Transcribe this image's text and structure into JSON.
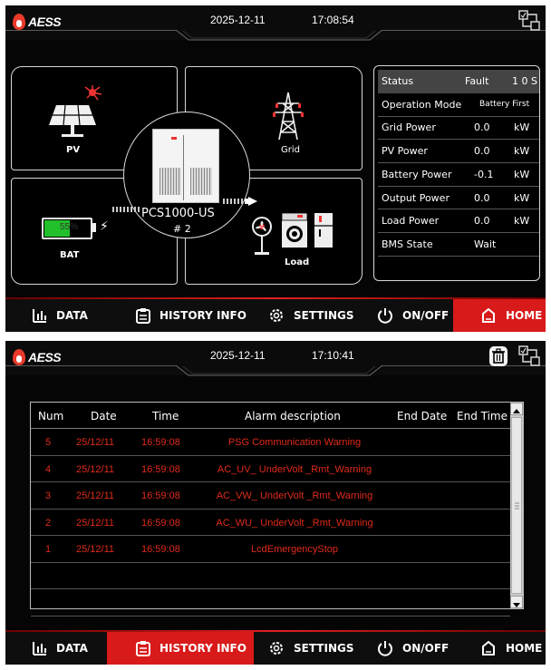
{
  "brand": "AESS",
  "screens": {
    "home": {
      "header": {
        "date": "2025-12-11",
        "time": "17:08:54"
      },
      "pv_label": "PV",
      "grid_label": "Grid",
      "bat_label": "BAT",
      "bat_percent_text": "55%",
      "bat_level": 0.55,
      "load_label": "Load",
      "pcs_model": "PCS1000-US",
      "pcs_number": "# 2",
      "status": {
        "header_label": "Status",
        "header_value": "Fault",
        "header_extra": "1 0 S",
        "rows": [
          {
            "label": "Operation Mode",
            "value": "Battery First",
            "unit": ""
          },
          {
            "label": "Grid Power",
            "value": "0.0",
            "unit": "kW"
          },
          {
            "label": "PV Power",
            "value": "0.0",
            "unit": "kW"
          },
          {
            "label": "Battery Power",
            "value": "-0.1",
            "unit": "kW"
          },
          {
            "label": "Output Power",
            "value": "0.0",
            "unit": "kW"
          },
          {
            "label": "Load Power",
            "value": "0.0",
            "unit": "kW"
          },
          {
            "label": "BMS State",
            "value": "Wait",
            "unit": ""
          }
        ]
      },
      "active_nav": "home"
    },
    "history": {
      "header": {
        "date": "2025-12-11",
        "time": "17:10:41"
      },
      "columns": [
        "Num",
        "Date",
        "Time",
        "Alarm description",
        "End Date",
        "End Time"
      ],
      "rows": [
        {
          "num": "5",
          "date": "25/12/11",
          "time": "16:59:08",
          "desc": "PSG Communication Warning",
          "end_date": "",
          "end_time": ""
        },
        {
          "num": "4",
          "date": "25/12/11",
          "time": "16:59:08",
          "desc": "AC_UV_ UnderVolt _Rmt_Warning",
          "end_date": "",
          "end_time": ""
        },
        {
          "num": "3",
          "date": "25/12/11",
          "time": "16:59:08",
          "desc": "AC_VW_ UnderVolt _Rmt_Warning",
          "end_date": "",
          "end_time": ""
        },
        {
          "num": "2",
          "date": "25/12/11",
          "time": "16:59:08",
          "desc": "AC_WU_ UnderVolt _Rmt_Warning",
          "end_date": "",
          "end_time": ""
        },
        {
          "num": "1",
          "date": "25/12/11",
          "time": "16:59:08",
          "desc": "LcdEmergencyStop",
          "end_date": "",
          "end_time": ""
        }
      ],
      "active_nav": "history"
    }
  },
  "nav": {
    "data": "DATA",
    "history": "HISTORY INFO",
    "settings": "SETTINGS",
    "onoff": "ON/OFF",
    "home": "HOME"
  },
  "colors": {
    "accent": "#d81a1a",
    "alarm_text": "#e02a1a",
    "background": "#050505"
  },
  "icons": [
    "logo-flame-icon",
    "network-icon",
    "trash-icon",
    "chart-icon",
    "clipboard-icon",
    "gear-icon",
    "power-icon",
    "home-icon",
    "solar-panel-icon",
    "transmission-tower-icon",
    "battery-icon",
    "fan-icon",
    "washer-icon",
    "fridge-icon"
  ]
}
